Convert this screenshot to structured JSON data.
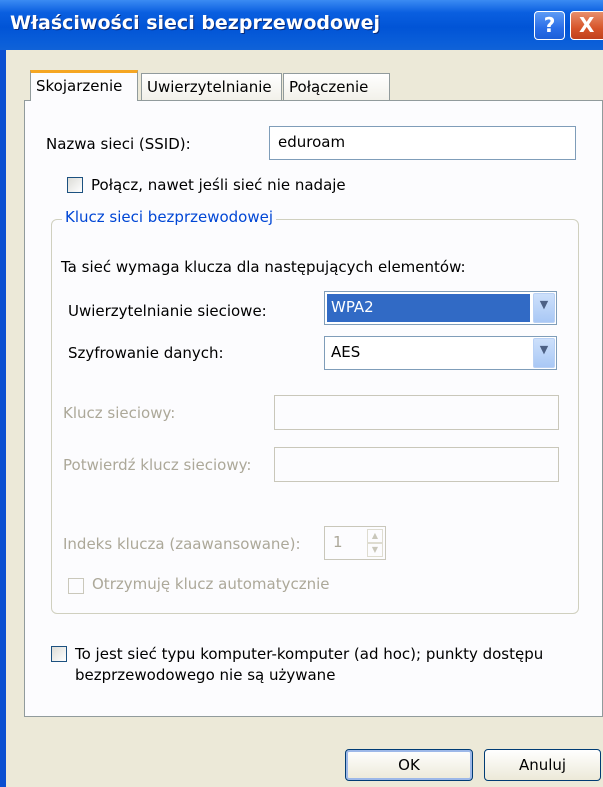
{
  "window": {
    "title": "Właściwości sieci bezprzewodowej",
    "help_glyph": "?",
    "close_glyph": "X"
  },
  "tabs": [
    {
      "label": "Skojarzenie",
      "selected": true
    },
    {
      "label": "Uwierzytelnianie",
      "selected": false
    },
    {
      "label": "Połączenie",
      "selected": false
    }
  ],
  "ssid": {
    "label": "Nazwa sieci (SSID):",
    "value": "eduroam"
  },
  "connect_even_if_not_broadcasting": {
    "label": "Połącz, nawet jeśli sieć nie nadaje",
    "checked": false
  },
  "wireless_key": {
    "group_title": "Klucz sieci bezprzewodowej",
    "intro": "Ta sieć wymaga klucza dla następujących elementów:",
    "auth": {
      "label": "Uwierzytelnianie sieciowe:",
      "value": "WPA2"
    },
    "encryption": {
      "label": "Szyfrowanie danych:",
      "value": "AES"
    },
    "network_key": {
      "label": "Klucz sieciowy:",
      "value": ""
    },
    "confirm_key": {
      "label": "Potwierdź klucz sieciowy:",
      "value": ""
    },
    "key_index": {
      "label": "Indeks klucza (zaawansowane):",
      "value": "1"
    },
    "auto_key": {
      "label": "Otrzymuję klucz automatycznie",
      "checked": false
    }
  },
  "adhoc": {
    "label_line1": "To jest sieć typu komputer-komputer (ad hoc); punkty dostępu",
    "label_line2": "bezprzewodowego nie są używane",
    "checked": false
  },
  "buttons": {
    "ok": "OK",
    "cancel": "Anuluj"
  },
  "colors": {
    "titlebar": "#0154d6",
    "dialog_bg": "#ece9d8",
    "selection": "#316ac5",
    "group_title": "#0046d5"
  }
}
